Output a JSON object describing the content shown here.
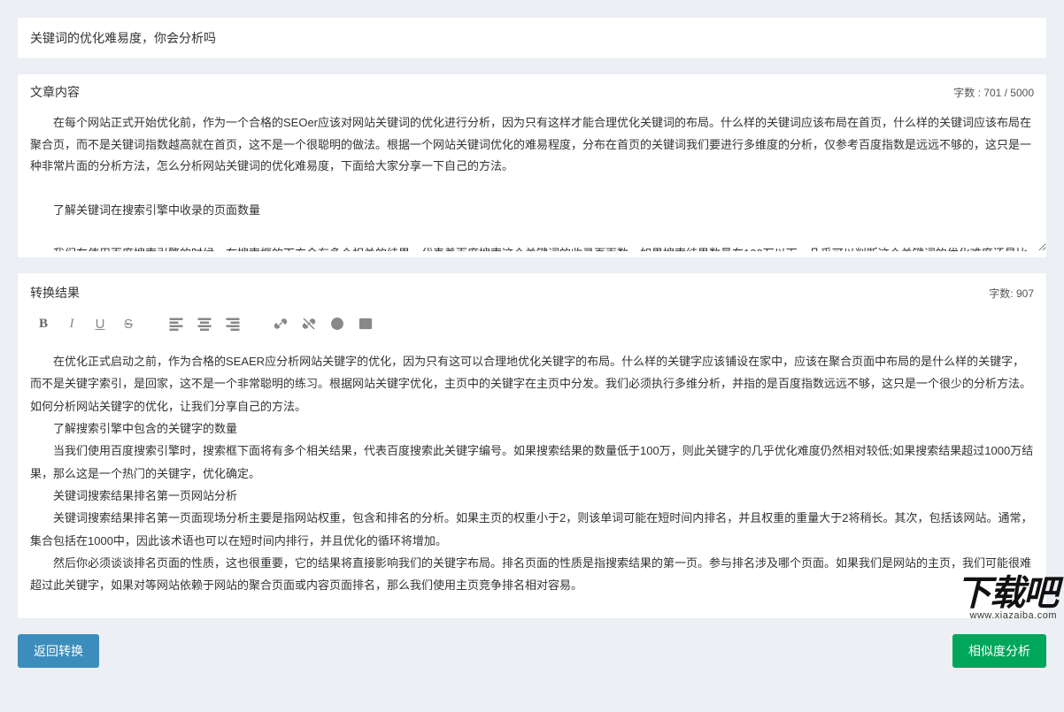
{
  "title_input": {
    "value": "关键词的优化难易度，你会分析吗"
  },
  "content_section": {
    "header": "文章内容",
    "char_count_label": "字数 : 701 / 5000",
    "textarea_value": "在每个网站正式开始优化前，作为一个合格的SEOer应该对网站关键词的优化进行分析，因为只有这样才能合理优化关键词的布局。什么样的关键词应该布局在首页，什么样的关键词应该布局在聚合页，而不是关键词指数越高就在首页，这不是一个很聪明的做法。根据一个网站关键词优化的难易程度，分布在首页的关键词我们要进行多维度的分析，仅参考百度指数是远远不够的，这只是一种非常片面的分析方法，怎么分析网站关键词的优化难易度，下面给大家分享一下自己的方法。\n\n　　了解关键词在搜索引擎中收录的页面数量\n\n　　我们在使用百度搜索引擎的时候，在搜索框的下方会有多个相关的结果，代表着百度搜索这个关键词的收录页面数。如果搜索结果数量在100万以下，几乎可以判断这个关键词的优化难度还是比较低的；如果搜索结果在1000万以上的结果，那么这是一个热门关键词，优化是有一定难度的。\n\n　　关键词搜索结果排名第一页网站分析"
  },
  "result_section": {
    "header": "转换结果",
    "char_count_label": "字数: 907",
    "paragraphs": [
      "在优化正式启动之前，作为合格的SEAER应分析网站关键字的优化，因为只有这可以合理地优化关键字的布局。什么样的关键字应该铺设在家中，应该在聚合页面中布局的是什么样的关键字，而不是关键字索引，是回家，这不是一个非常聪明的练习。根据网站关键字优化，主页中的关键字在主页中分发。我们必须执行多维分析，并指的是百度指数远远不够，这只是一个很少的分析方法。如何分析网站关键字的优化，让我们分享自己的方法。",
      "了解搜索引擎中包含的关键字的数量",
      "当我们使用百度搜索引擎时，搜索框下面将有多个相关结果，代表百度搜索此关键字编号。如果搜索结果的数量低于100万，则此关键字的几乎优化难度仍然相对较低;如果搜索结果超过1000万结果，那么这是一个热门的关键字，优化确定。",
      "关键词搜索结果排名第一页网站分析",
      "关键词搜索结果排名第一页面现场分析主要是指网站权重，包含和排名的分析。如果主页的权重小于2，则该单词可能在短时间内排名，并且权重的重量大于2将稍长。其次，包括该网站。通常，集合包括在1000中，因此该术语也可以在短时间内排行，并且优化的循环将增加。",
      "然后你必须谈谈排名页面的性质，这也很重要，它的结果将直接影响我们的关键字布局。排名页面的性质是指搜索结果的第一页。参与排名涉及哪个页面。如果我们是网站的主页，我们可能很难超过此关键字，如果对等网站依赖于网站的聚合页面或内容页面排名，那么我们使用主页竞争排名相对容易。"
    ]
  },
  "toolbar": {
    "bold": "B",
    "italic": "I",
    "underline": "U",
    "strike": "S"
  },
  "footer": {
    "back_btn": "返回转换",
    "sim_btn": "相似度分析"
  },
  "watermark": {
    "main": "下载吧",
    "sub": "www.xiazaiba.com"
  }
}
